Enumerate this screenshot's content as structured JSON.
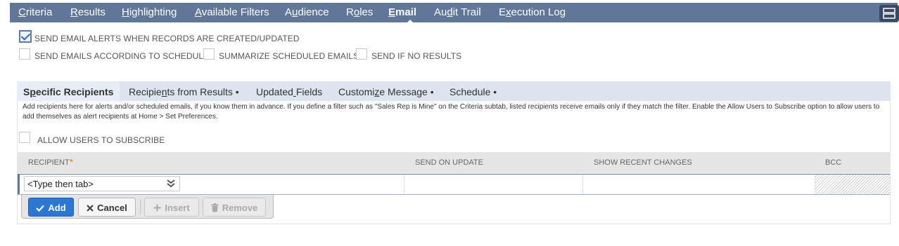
{
  "nav": {
    "tabs": [
      {
        "pre": "",
        "u": "C",
        "post": "riteria"
      },
      {
        "pre": "",
        "u": "R",
        "post": "esults"
      },
      {
        "pre": "",
        "u": "H",
        "post": "ighlighting"
      },
      {
        "pre": "",
        "u": "A",
        "post": "vailable Filters"
      },
      {
        "pre": "A",
        "u": "u",
        "post": "dience"
      },
      {
        "pre": "R",
        "u": "o",
        "post": "les"
      },
      {
        "pre": "",
        "u": "E",
        "post": "mail"
      },
      {
        "pre": "Au",
        "u": "d",
        "post": "it Trail"
      },
      {
        "pre": "E",
        "u": "x",
        "post": "ecution Log"
      }
    ],
    "active_tab": "Email"
  },
  "options": {
    "send_on_create_update": {
      "label": "SEND EMAIL ALERTS WHEN RECORDS ARE CREATED/UPDATED",
      "checked": true
    },
    "send_by_schedule": {
      "label": "SEND EMAILS ACCORDING TO SCHEDULE",
      "checked": false
    },
    "summarize": {
      "label": "SUMMARIZE SCHEDULED EMAILS",
      "checked": false
    },
    "send_if_no_results": {
      "label": "SEND IF NO RESULTS",
      "checked": false
    }
  },
  "subtabs": [
    {
      "pre": "S",
      "u": "p",
      "post": "ecific Recipients"
    },
    {
      "pre": "Recipie",
      "u": "n",
      "post": "ts from Results •"
    },
    {
      "pre": "Updated",
      "u": " ",
      "post": "Fields"
    },
    {
      "pre": "Customi",
      "u": "z",
      "post": "e Message •"
    },
    {
      "pre": "Schedule •",
      "u": "",
      "post": ""
    }
  ],
  "help_text": "Add recipients here for alerts and/or scheduled emails, if you know them in advance. If you define a filter such as \"Sales Rep is Mine\" on the Criteria subtab, listed recipients receive emails only if they match the filter. Enable the Allow Users to Subscribe option to allow users to add themselves as alert recipients at Home > Set Preferences.",
  "allow_subscribe": {
    "label": "ALLOW USERS TO SUBSCRIBE",
    "checked": false
  },
  "table": {
    "columns": [
      "RECIPIENT",
      "SEND ON UPDATE",
      "SHOW RECENT CHANGES",
      "BCC"
    ],
    "recipient_placeholder": "<Type then tab>"
  },
  "buttons": {
    "add": "Add",
    "cancel": "Cancel",
    "insert": "Insert",
    "remove": "Remove"
  },
  "colors": {
    "nav_bg": "#607799",
    "primary": "#2a78d4",
    "required": "#e08a00"
  }
}
